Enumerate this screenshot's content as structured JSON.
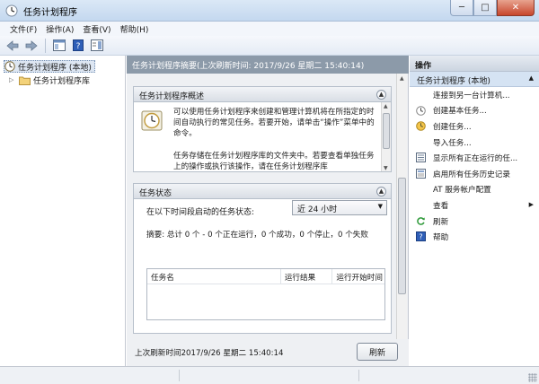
{
  "window": {
    "title": "任务计划程序",
    "minimize_glyph": "─",
    "maximize_glyph": "□",
    "close_glyph": "✕"
  },
  "menu": [
    "文件(F)",
    "操作(A)",
    "查看(V)",
    "帮助(H)"
  ],
  "toolbar": {
    "icons": [
      "back-arrow-icon",
      "forward-arrow-icon",
      "show-tree-icon",
      "help-icon",
      "properties-icon"
    ]
  },
  "tree": {
    "root_label": "任务计划程序 (本地)",
    "child_label": "任务计划程序库",
    "expander_glyph": "▷"
  },
  "center": {
    "header": "任务计划程序摘要(上次刷新时间: 2017/9/26 星期二 15:40:14)",
    "overview": {
      "title": "任务计划程序概述",
      "text_1": "可以使用任务计划程序来创建和管理计算机将在所指定的时间自动执行的常见任务。若要开始，请单击“操作”菜单中的命令。",
      "text_2": "任务存储在任务计划程序库的文件夹中。若要查看单独任务上的操作或执行该操作，请在任务计划程序库"
    },
    "status": {
      "title": "任务状态",
      "prompt": "在以下时间段启动的任务状态:",
      "selected_range": "近 24 小时",
      "summary": "摘要: 总计 0 个 - 0 个正在运行，0 个成功，0 个停止，0 个失败",
      "columns": [
        "任务名",
        "运行结果",
        "运行开始时间"
      ]
    },
    "footer": {
      "last_refresh": "上次刷新时间2017/9/26 星期二 15:40:14",
      "refresh_label": "刷新"
    }
  },
  "actions": {
    "header": "操作",
    "group_label": "任务计划程序 (本地)",
    "items": [
      {
        "label": "连接到另一台计算机...",
        "icon": "none"
      },
      {
        "label": "创建基本任务...",
        "icon": "wizard-icon"
      },
      {
        "label": "创建任务...",
        "icon": "task-icon"
      },
      {
        "label": "导入任务...",
        "icon": "none"
      },
      {
        "label": "显示所有正在运行的任...",
        "icon": "running-tasks-icon"
      },
      {
        "label": "启用所有任务历史记录",
        "icon": "history-icon"
      },
      {
        "label": "AT 服务帐户配置",
        "icon": "none"
      },
      {
        "label": "查看",
        "icon": "none",
        "submenu": true
      },
      {
        "label": "刷新",
        "icon": "refresh-icon"
      },
      {
        "label": "帮助",
        "icon": "help-icon"
      }
    ]
  },
  "colors": {
    "center_header_bg": "#8c9aa9",
    "selection_bg": "#d5e3f3"
  }
}
